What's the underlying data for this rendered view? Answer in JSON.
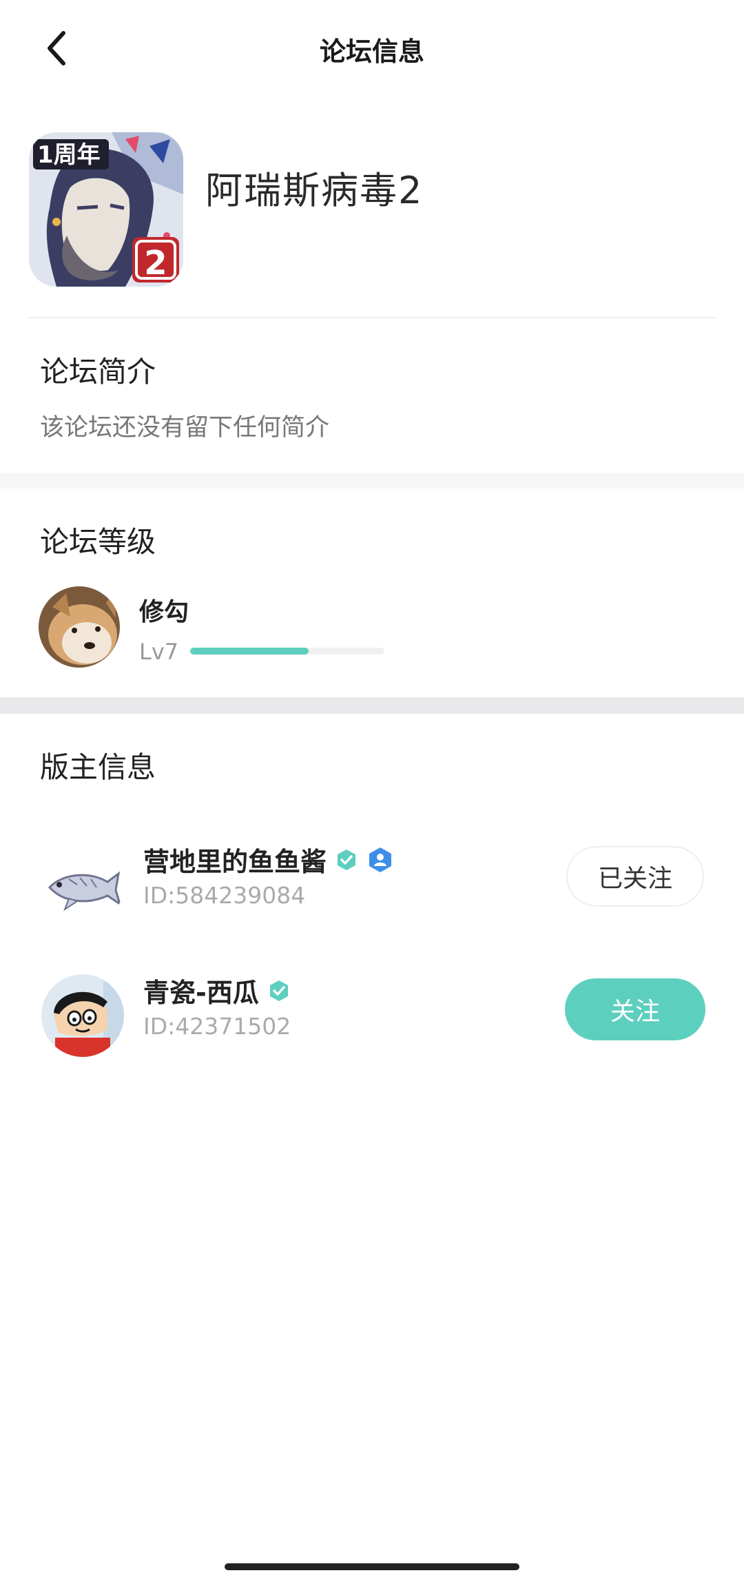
{
  "header": {
    "title": "论坛信息",
    "back_icon": "chevron-left-icon"
  },
  "forum": {
    "name": "阿瑞斯病毒2",
    "icon_badge_text": "1周年",
    "icon_number": "2"
  },
  "intro": {
    "title": "论坛简介",
    "text": "该论坛还没有留下任何简介"
  },
  "level": {
    "title": "论坛等级",
    "user_name": "修勾",
    "level_label": "Lv7",
    "progress": 0.61,
    "progress_color": "#5ecfbf"
  },
  "moderators": {
    "title": "版主信息",
    "items": [
      {
        "name": "营地里的鱼鱼酱",
        "id_text": "ID:584239084",
        "button": "已关注",
        "followed": true
      },
      {
        "name": "青瓷-西瓜",
        "id_text": "ID:42371502",
        "button": "关注",
        "followed": false
      }
    ]
  },
  "colors": {
    "accent": "#5dcfbf",
    "verified_badge": "#5ecfbf",
    "admin_badge": "#3d8ee8"
  }
}
